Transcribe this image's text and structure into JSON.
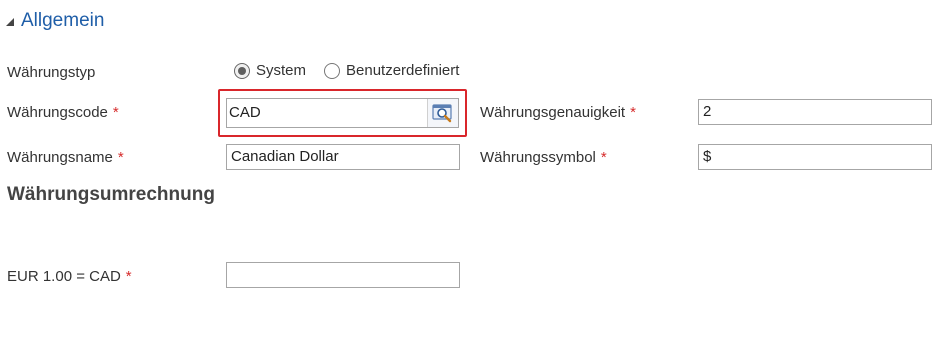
{
  "section": {
    "title": "Allgemein"
  },
  "currency_type": {
    "label": "Währungstyp",
    "options": [
      "System",
      "Benutzerdefiniert"
    ],
    "selected": "System"
  },
  "currency_code": {
    "label": "Währungscode",
    "required_mark": "*",
    "value": "CAD"
  },
  "currency_precision": {
    "label": "Währungsgenauigkeit",
    "required_mark": "*",
    "value": "2"
  },
  "currency_name": {
    "label": "Währungsname",
    "required_mark": "*",
    "value": "Canadian Dollar"
  },
  "currency_symbol": {
    "label": "Währungssymbol",
    "required_mark": "*",
    "value": "$"
  },
  "conversion": {
    "heading": "Währungsumrechnung",
    "label": "EUR 1.00 = CAD",
    "required_mark": "*",
    "value": ""
  },
  "colors": {
    "accent": "#1f5ea8",
    "required": "#d62b2b",
    "highlight": "#d9262b"
  },
  "icons": {
    "section_toggle": "triangle-collapse-icon",
    "lookup": "lookup-magnifier-icon"
  }
}
